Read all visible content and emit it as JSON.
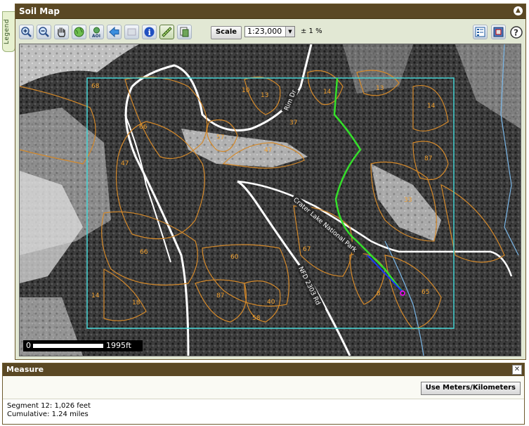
{
  "legend_tab": {
    "label": "Legend"
  },
  "soil_map": {
    "title": "Soil Map",
    "toolbar": {
      "buttons": [
        {
          "name": "zoom-in-icon"
        },
        {
          "name": "zoom-out-icon"
        },
        {
          "name": "pan-hand-icon"
        },
        {
          "name": "full-extent-globe-icon"
        },
        {
          "name": "zoom-to-aoi-icon",
          "text": "AOI"
        },
        {
          "name": "back-arrow-icon"
        },
        {
          "name": "forward-disabled-icon"
        },
        {
          "name": "identify-info-icon",
          "text": "i"
        },
        {
          "name": "measure-ruler-icon"
        },
        {
          "name": "print-map-icon"
        }
      ],
      "scale_label": "Scale",
      "scale_value": "1:23,000",
      "accuracy": "± 1 %"
    },
    "map": {
      "road_labels": [
        "Rim Dr",
        "Crater Lake National Park",
        "NFD 2303 Rd"
      ],
      "soil_units": [
        "68",
        "10",
        "13",
        "14",
        "13",
        "14",
        "66",
        "57",
        "37",
        "47",
        "47",
        "87",
        "33",
        "66",
        "60",
        "67",
        "14",
        "18",
        "87",
        "58",
        "40",
        "8",
        "65"
      ],
      "scale_bar": {
        "start": "0",
        "distance": "1995ft"
      },
      "colors": {
        "soil_lines": "#d4892a",
        "aoi_box": "#47d6d6",
        "measure_line": "#35e02a",
        "roads": "#ffffff"
      }
    }
  },
  "measure": {
    "title": "Measure",
    "units_button": "Use Meters/Kilometers",
    "segment": "Segment 12: 1,026 feet",
    "cumulative": "Cumulative: 1.24 miles"
  }
}
